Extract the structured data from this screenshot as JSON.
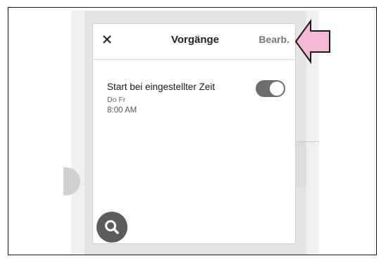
{
  "header": {
    "close_label": "×",
    "title": "Vorgänge",
    "edit_label": "Bearb."
  },
  "process": {
    "title": "Start bei eingestellter Zeit",
    "days": "Do Fr",
    "time": "8:00 AM",
    "enabled": true
  },
  "icons": {
    "close": "close-icon",
    "search": "search-icon",
    "pointer": "arrow-pointer-icon"
  },
  "colors": {
    "toggle_on": "#6e6e6e",
    "fab": "#5c5c5c",
    "edit_text": "#777777",
    "arrow_fill": "#f6b8d4"
  }
}
